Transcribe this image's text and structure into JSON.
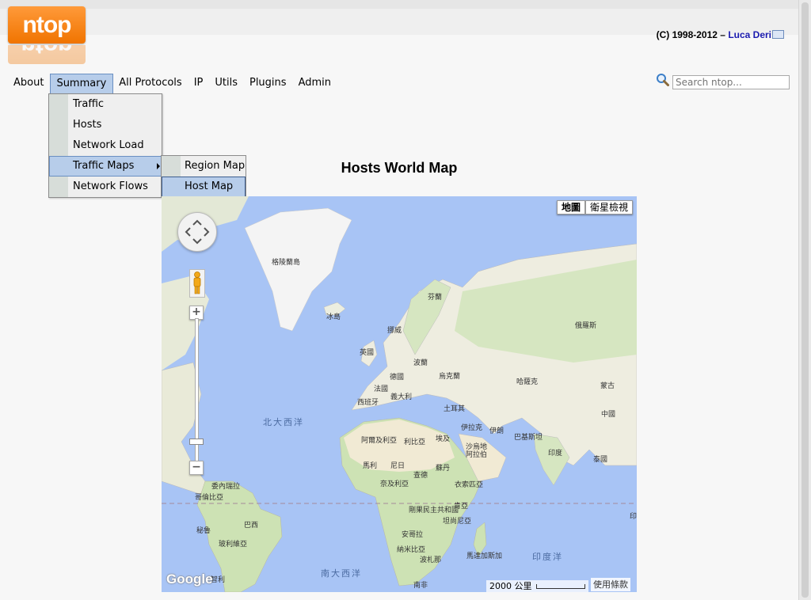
{
  "header": {
    "logo_text": "ntop",
    "logo_reflection_text": "ntop",
    "copyright_prefix": "(C) 1998-2012 – ",
    "author": "Luca Deri"
  },
  "menu": {
    "items": [
      {
        "label": "About"
      },
      {
        "label": "Summary",
        "active": true
      },
      {
        "label": "All Protocols"
      },
      {
        "label": "IP"
      },
      {
        "label": "Utils"
      },
      {
        "label": "Plugins"
      },
      {
        "label": "Admin"
      }
    ],
    "summary_dropdown": [
      {
        "label": "Traffic"
      },
      {
        "label": "Hosts"
      },
      {
        "label": "Network Load"
      },
      {
        "label": "Traffic Maps",
        "highlighted": true,
        "has_submenu": true
      },
      {
        "label": "Network Flows"
      }
    ],
    "traffic_maps_submenu": [
      {
        "label": "Region Map"
      },
      {
        "label": "Host Map",
        "highlighted": true
      }
    ]
  },
  "search": {
    "placeholder": "Search ntop..."
  },
  "page": {
    "title": "Hosts World Map"
  },
  "map": {
    "type_buttons": [
      {
        "label": "地圖",
        "selected": true
      },
      {
        "label": "衛星檢視",
        "selected": false
      }
    ],
    "labels": {
      "greenland": "格陵蘭島",
      "iceland": "冰島",
      "finland": "芬蘭",
      "norway": "挪威",
      "russia": "俄羅斯",
      "uk": "英國",
      "poland": "波蘭",
      "germany": "德國",
      "ukraine": "烏克蘭",
      "france": "法國",
      "kazakhstan": "哈薩克",
      "mongolia": "蒙古",
      "italy": "義大利",
      "spain": "西班牙",
      "turkey": "土耳其",
      "china": "中國",
      "north_atlantic": "北大西洋",
      "iraq": "伊拉克",
      "iran": "伊朗",
      "algeria": "阿爾及利亞",
      "libya": "利比亞",
      "egypt": "埃及",
      "pakistan": "巴基斯坦",
      "saudi": "沙烏地",
      "arabia": "阿拉伯",
      "india": "印度",
      "thailand": "泰國",
      "mali": "馬利",
      "niger": "尼日",
      "sudan": "蘇丹",
      "chad": "查德",
      "venezuela": "委內瑞拉",
      "nigeria": "奈及利亞",
      "ethiopia": "衣索匹亞",
      "colombia": "哥倫比亞",
      "drc": "剛果民主共和國",
      "kenya": "肯亞",
      "peru": "秘魯",
      "brazil": "巴西",
      "tanzania": "坦尚尼亞",
      "bolivia": "玻利維亞",
      "angola": "安哥拉",
      "namibia": "納米比亞",
      "botswana": "波札那",
      "madagascar": "馬達加斯加",
      "indian_ocean": "印度洋",
      "south_atlantic": "南大西洋",
      "south_africa": "南非",
      "chile": "智利",
      "philippines": "印"
    },
    "google_logo": "Google",
    "scale_label": "2000 公里",
    "terms": "使用條款"
  },
  "colors": {
    "ocean": "#a8c4f5",
    "land": "#eeede0",
    "green_land": "#cde2b4",
    "desert": "#f1ead4",
    "menu_active": "#b7cdea",
    "logo_orange": "#f07400"
  }
}
